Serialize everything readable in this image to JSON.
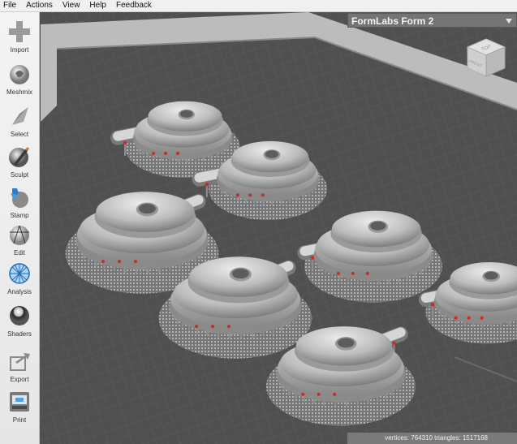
{
  "menu": [
    "File",
    "Actions",
    "View",
    "Help",
    "Feedback"
  ],
  "tools": [
    {
      "label": "Import",
      "icon": "plus-icon"
    },
    {
      "label": "Meshmix",
      "icon": "bunny-head-icon"
    },
    {
      "label": "Select",
      "icon": "arrow-cursor-icon"
    },
    {
      "label": "Sculpt",
      "icon": "brush-icon"
    },
    {
      "label": "Stamp",
      "icon": "stamp-icon"
    },
    {
      "label": "Edit",
      "icon": "edit-sphere-icon"
    },
    {
      "label": "Analysis",
      "icon": "mesh-sphere-icon"
    },
    {
      "label": "Shaders",
      "icon": "chrome-sphere-icon"
    },
    {
      "label": "Export",
      "icon": "export-arrow-icon"
    },
    {
      "label": "Print",
      "icon": "printer-icon"
    }
  ],
  "printer": {
    "name": "FormLabs Form 2"
  },
  "navcube": {
    "top_face": "TOP",
    "front_face": "FRONT"
  },
  "status": {
    "text": "vertices: 764310 triangles: 1517168"
  },
  "colors": {
    "accent_support_tip": "#cc2a2a",
    "model": "#c4c4c4",
    "build_plate": "#505050"
  }
}
